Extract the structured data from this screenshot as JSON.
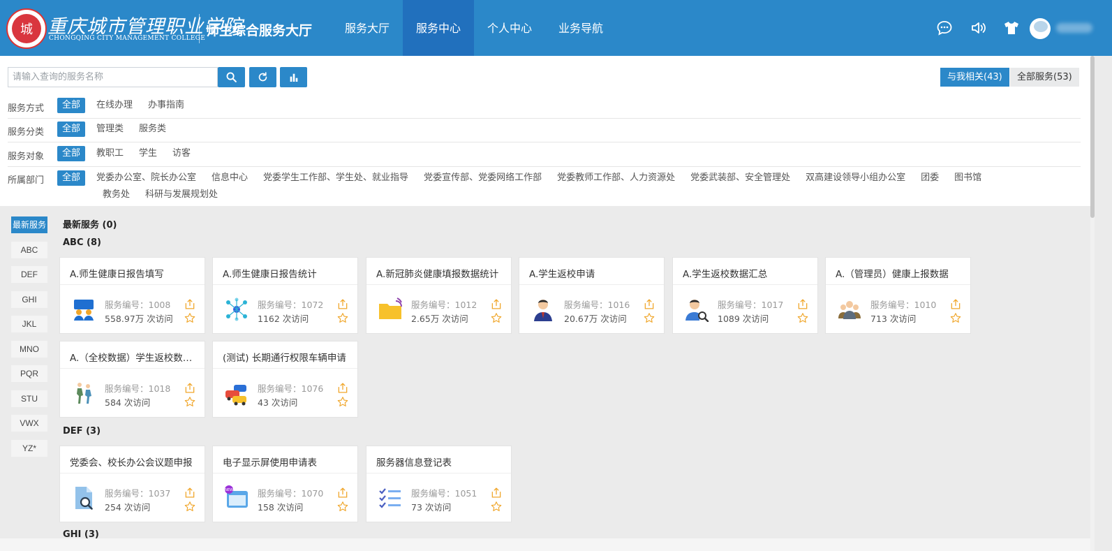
{
  "header": {
    "logo_char": "城",
    "school_name_cn": "重庆城市管理职业学院",
    "school_name_en": "CHONGQING CITY MANAGEMENT COLLEGE",
    "hall_title": "师生综合服务大厅",
    "nav": [
      {
        "label": "服务大厅",
        "active": false
      },
      {
        "label": "服务中心",
        "active": true
      },
      {
        "label": "个人中心",
        "active": false
      },
      {
        "label": "业务导航",
        "active": false
      }
    ],
    "icons": [
      "chat-icon",
      "volume-icon",
      "tshirt-icon"
    ]
  },
  "search": {
    "placeholder": "请输入查询的服务名称",
    "value": ""
  },
  "scope": {
    "related": "与我相关(43)",
    "all": "全部服务(53)"
  },
  "filters": {
    "method": {
      "label": "服务方式",
      "options": [
        "全部",
        "在线办理",
        "办事指南"
      ]
    },
    "category": {
      "label": "服务分类",
      "options": [
        "全部",
        "管理类",
        "服务类"
      ]
    },
    "audience": {
      "label": "服务对象",
      "options": [
        "全部",
        "教职工",
        "学生",
        "访客"
      ]
    },
    "department": {
      "label": "所属部门",
      "options": [
        "全部",
        "党委办公室、院长办公室",
        "信息中心",
        "党委学生工作部、学生处、就业指导",
        "党委宣传部、党委网络工作部",
        "党委教师工作部、人力资源处",
        "党委武装部、安全管理处",
        "双高建设领导小组办公室",
        "团委",
        "图书馆",
        "教务处",
        "科研与发展规划处"
      ]
    }
  },
  "letters": [
    "最新服务",
    "ABC",
    "DEF",
    "GHI",
    "JKL",
    "MNO",
    "PQR",
    "STU",
    "VWX",
    "YZ*"
  ],
  "sections": {
    "newest": "最新服务 (0)",
    "abc": "ABC (8)",
    "def": "DEF (3)",
    "ghi": "GHI (3)"
  },
  "cards": [
    {
      "title": "A.师生健康日报告填写",
      "no": "服务编号：1008",
      "visits": "558.97万 次访问",
      "icon": "users-board-icon",
      "color": "#1f6fd1"
    },
    {
      "title": "A.师生健康日报告统计",
      "no": "服务编号：1072",
      "visits": "1162 次访问",
      "icon": "network-icon",
      "color": "#2bb3d6"
    },
    {
      "title": "A.新冠肺炎健康填报数据统计",
      "no": "服务编号：1012",
      "visits": "2.65万 次访问",
      "icon": "folder-icon",
      "color": "#f7c12b"
    },
    {
      "title": "A.学生返校申请",
      "no": "服务编号：1016",
      "visits": "20.67万 次访问",
      "icon": "person-icon",
      "color": "#c0392b"
    },
    {
      "title": "A.学生返校数据汇总",
      "no": "服务编号：1017",
      "visits": "1089 次访问",
      "icon": "person-search-icon",
      "color": "#3a7bd5"
    },
    {
      "title": "A.（管理员）健康上报数据",
      "no": "服务编号：1010",
      "visits": "713 次访问",
      "icon": "group-icon",
      "color": "#8a6d3b"
    },
    {
      "title": "A.（全校数据）学生返校数据汇总",
      "no": "服务编号：1018",
      "visits": "584 次访问",
      "icon": "walking-icon",
      "color": "#5c8a5c"
    },
    {
      "title": "(测试) 长期通行权限车辆申请",
      "no": "服务编号：1076",
      "visits": "43 次访问",
      "icon": "cars-icon",
      "color": "#e74c3c"
    },
    {
      "title": "党委会、校长办公会议题申报",
      "no": "服务编号：1037",
      "visits": "254 次访问",
      "icon": "doc-search-icon",
      "color": "#3a8fd8"
    },
    {
      "title": "电子显示屏使用申请表",
      "no": "服务编号：1070",
      "visits": "158 次访问",
      "icon": "screen-new-icon",
      "color": "#5aa7e8"
    },
    {
      "title": "服务器信息登记表",
      "no": "服务编号：1051",
      "visits": "73 次访问",
      "icon": "checklist-icon",
      "color": "#4a5fc1"
    }
  ],
  "colors": {
    "primary": "#2b88c9",
    "nav_active": "#2170bd",
    "accent_gold": "#f0a62a"
  }
}
